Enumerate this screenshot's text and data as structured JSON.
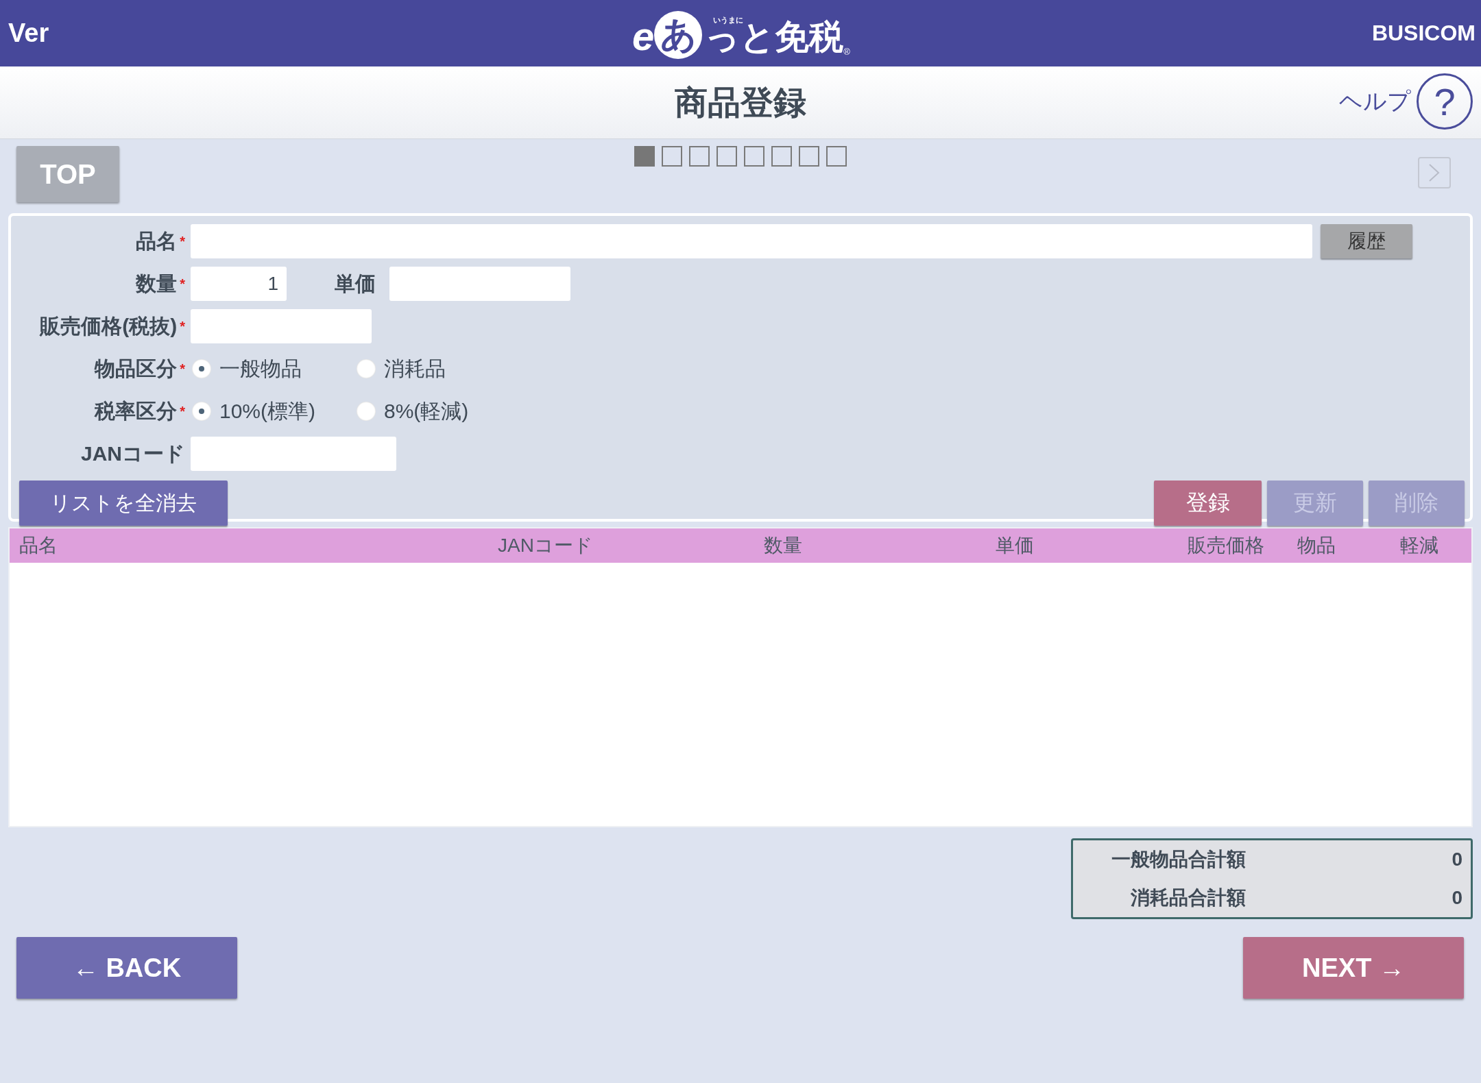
{
  "header": {
    "version": "Ver",
    "logo": {
      "e": "e",
      "a": "あ",
      "ruby": "いうまに",
      "rest": "っと免税",
      "mark": "®"
    },
    "brand": "BUSICOM"
  },
  "title_bar": {
    "title": "商品登録",
    "help": "ヘルプ",
    "help_icon": "?"
  },
  "top_button": "TOP",
  "steps": [
    {
      "selected": true
    },
    {
      "selected": false
    },
    {
      "selected": false
    },
    {
      "selected": false
    },
    {
      "selected": false
    },
    {
      "selected": false
    },
    {
      "selected": false
    },
    {
      "selected": false
    }
  ],
  "form": {
    "name": {
      "label": "品名",
      "required_mark": "*",
      "history_button": "履歴"
    },
    "quantity": {
      "label": "数量",
      "required_mark": "*",
      "value": "1"
    },
    "unit_price": {
      "label": "単価"
    },
    "sale_price": {
      "label": "販売価格(税抜)",
      "required_mark": "*"
    },
    "item_type": {
      "label": "物品区分",
      "required_mark": "*",
      "options": [
        {
          "label": "一般物品",
          "selected": true
        },
        {
          "label": "消耗品",
          "selected": false
        }
      ]
    },
    "tax_type": {
      "label": "税率区分",
      "required_mark": "*",
      "options": [
        {
          "label": "10%(標準)",
          "selected": true
        },
        {
          "label": "8%(軽減)",
          "selected": false
        }
      ]
    },
    "jan": {
      "label": "JANコード"
    },
    "clear_button": "リストを全消去",
    "actions": [
      {
        "label": "登録",
        "kind": "primary",
        "disabled": false
      },
      {
        "label": "更新",
        "kind": "secondary",
        "disabled": true
      },
      {
        "label": "削除",
        "kind": "secondary",
        "disabled": true
      }
    ]
  },
  "table": {
    "columns": [
      "品名",
      "JANコード",
      "数量",
      "単価",
      "販売価格",
      "物品",
      "軽減"
    ]
  },
  "totals": [
    {
      "label": "一般物品合計額",
      "value": "0"
    },
    {
      "label": "消耗品合計額",
      "value": "0"
    }
  ],
  "back_button": "← BACK",
  "next_button": "NEXT →"
}
